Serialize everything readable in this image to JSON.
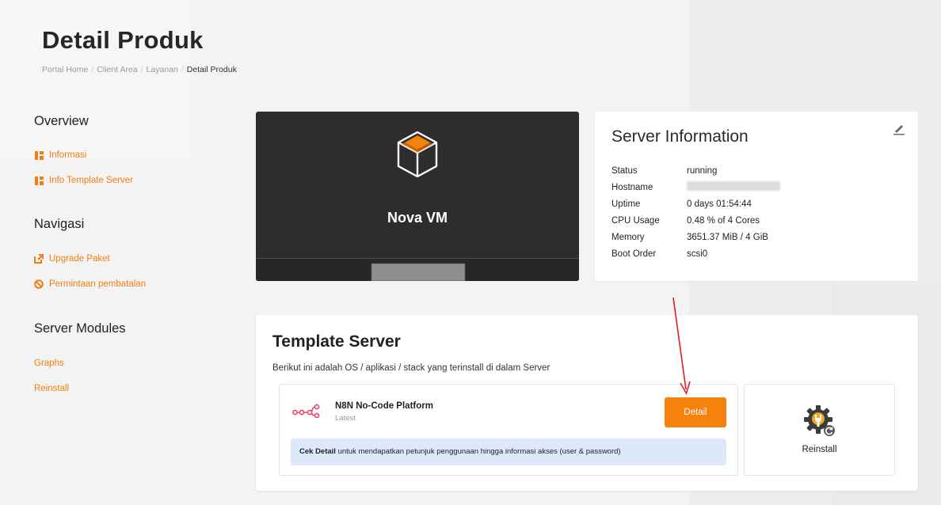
{
  "page": {
    "title": "Detail Produk",
    "breadcrumb": [
      "Portal Home",
      "Client Area",
      "Layanan",
      "Detail Produk"
    ]
  },
  "sidebar": {
    "overview_heading": "Overview",
    "overview_links": [
      {
        "label": "Informasi",
        "icon": "grid-icon"
      },
      {
        "label": "Info Template Server",
        "icon": "grid-icon"
      }
    ],
    "nav_heading": "Navigasi",
    "nav_links": [
      {
        "label": "Upgrade Paket",
        "icon": "external-link-icon"
      },
      {
        "label": "Permintaan pembatalan",
        "icon": "ban-icon"
      }
    ],
    "modules_heading": "Server Modules",
    "module_links": [
      {
        "label": "Graphs"
      },
      {
        "label": "Reinstall"
      }
    ]
  },
  "vm": {
    "name": "Nova VM",
    "icon": "cube-icon"
  },
  "server_info": {
    "title": "Server Information",
    "rows": [
      {
        "label": "Status",
        "value": "running"
      },
      {
        "label": "Hostname",
        "value": ""
      },
      {
        "label": "Uptime",
        "value": "0 days 01:54:44"
      },
      {
        "label": "CPU Usage",
        "value": "0.48 % of 4 Cores"
      },
      {
        "label": "Memory",
        "value": "3651.37 MiB / 4 GiB"
      },
      {
        "label": "Boot Order",
        "value": "scsi0"
      }
    ]
  },
  "template": {
    "title": "Template Server",
    "description": "Berikut ini adalah OS / aplikasi / stack yang terinstall di dalam Server",
    "app_name": "N8N No-Code Platform",
    "app_version": "Latest",
    "detail_button": "Detail",
    "note_bold": "Cek Detail",
    "note_rest": " untuk mendapatkan petunjuk penggunaan hingga informasi akses (user & password)",
    "reinstall_label": "Reinstall"
  },
  "colors": {
    "accent": "#f4820c",
    "note_bg": "#dde9fb",
    "vm_bg": "#2d2d2d",
    "annotation_arrow": "#e02020"
  }
}
